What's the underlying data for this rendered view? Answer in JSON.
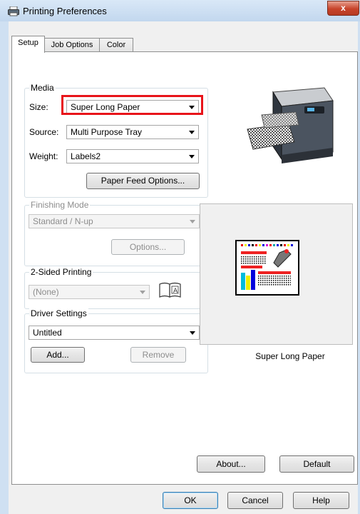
{
  "window": {
    "title": "Printing Preferences",
    "close_glyph": "x"
  },
  "tabs": [
    {
      "label": "Setup",
      "active": true
    },
    {
      "label": "Job Options",
      "active": false
    },
    {
      "label": "Color",
      "active": false
    }
  ],
  "media": {
    "group_label": "Media",
    "size_label": "Size:",
    "size_value": "Super Long Paper",
    "source_label": "Source:",
    "source_value": "Multi Purpose Tray",
    "weight_label": "Weight:",
    "weight_value": "Labels2",
    "paper_feed_button": "Paper Feed Options..."
  },
  "finishing": {
    "group_label": "Finishing Mode",
    "value": "Standard / N-up",
    "options_button": "Options..."
  },
  "two_sided": {
    "group_label": "2-Sided Printing",
    "value": "(None)"
  },
  "driver_settings": {
    "group_label": "Driver Settings",
    "value": "Untitled",
    "add_button": "Add...",
    "remove_button": "Remove"
  },
  "preview": {
    "caption": "Super Long Paper"
  },
  "footer": {
    "about_button": "About...",
    "default_button": "Default",
    "ok_button": "OK",
    "cancel_button": "Cancel",
    "help_button": "Help"
  },
  "colors": {
    "highlight": "#e8141a",
    "accent": "#3c7fb1"
  }
}
